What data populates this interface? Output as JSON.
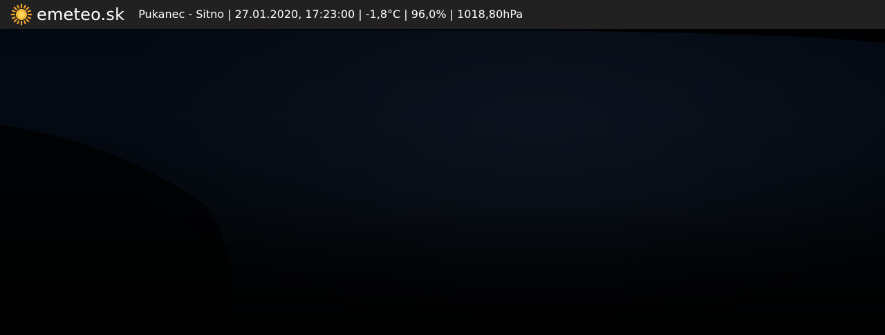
{
  "overlay": {
    "brand": "emeteo.sk",
    "brand_icon": "sun-icon",
    "brand_color": "#f5a623",
    "caption": "Pukanec - Sitno | 27.01.2020, 17:23:00 | -1,8°C | 96,0% | 1018,80hPa"
  }
}
